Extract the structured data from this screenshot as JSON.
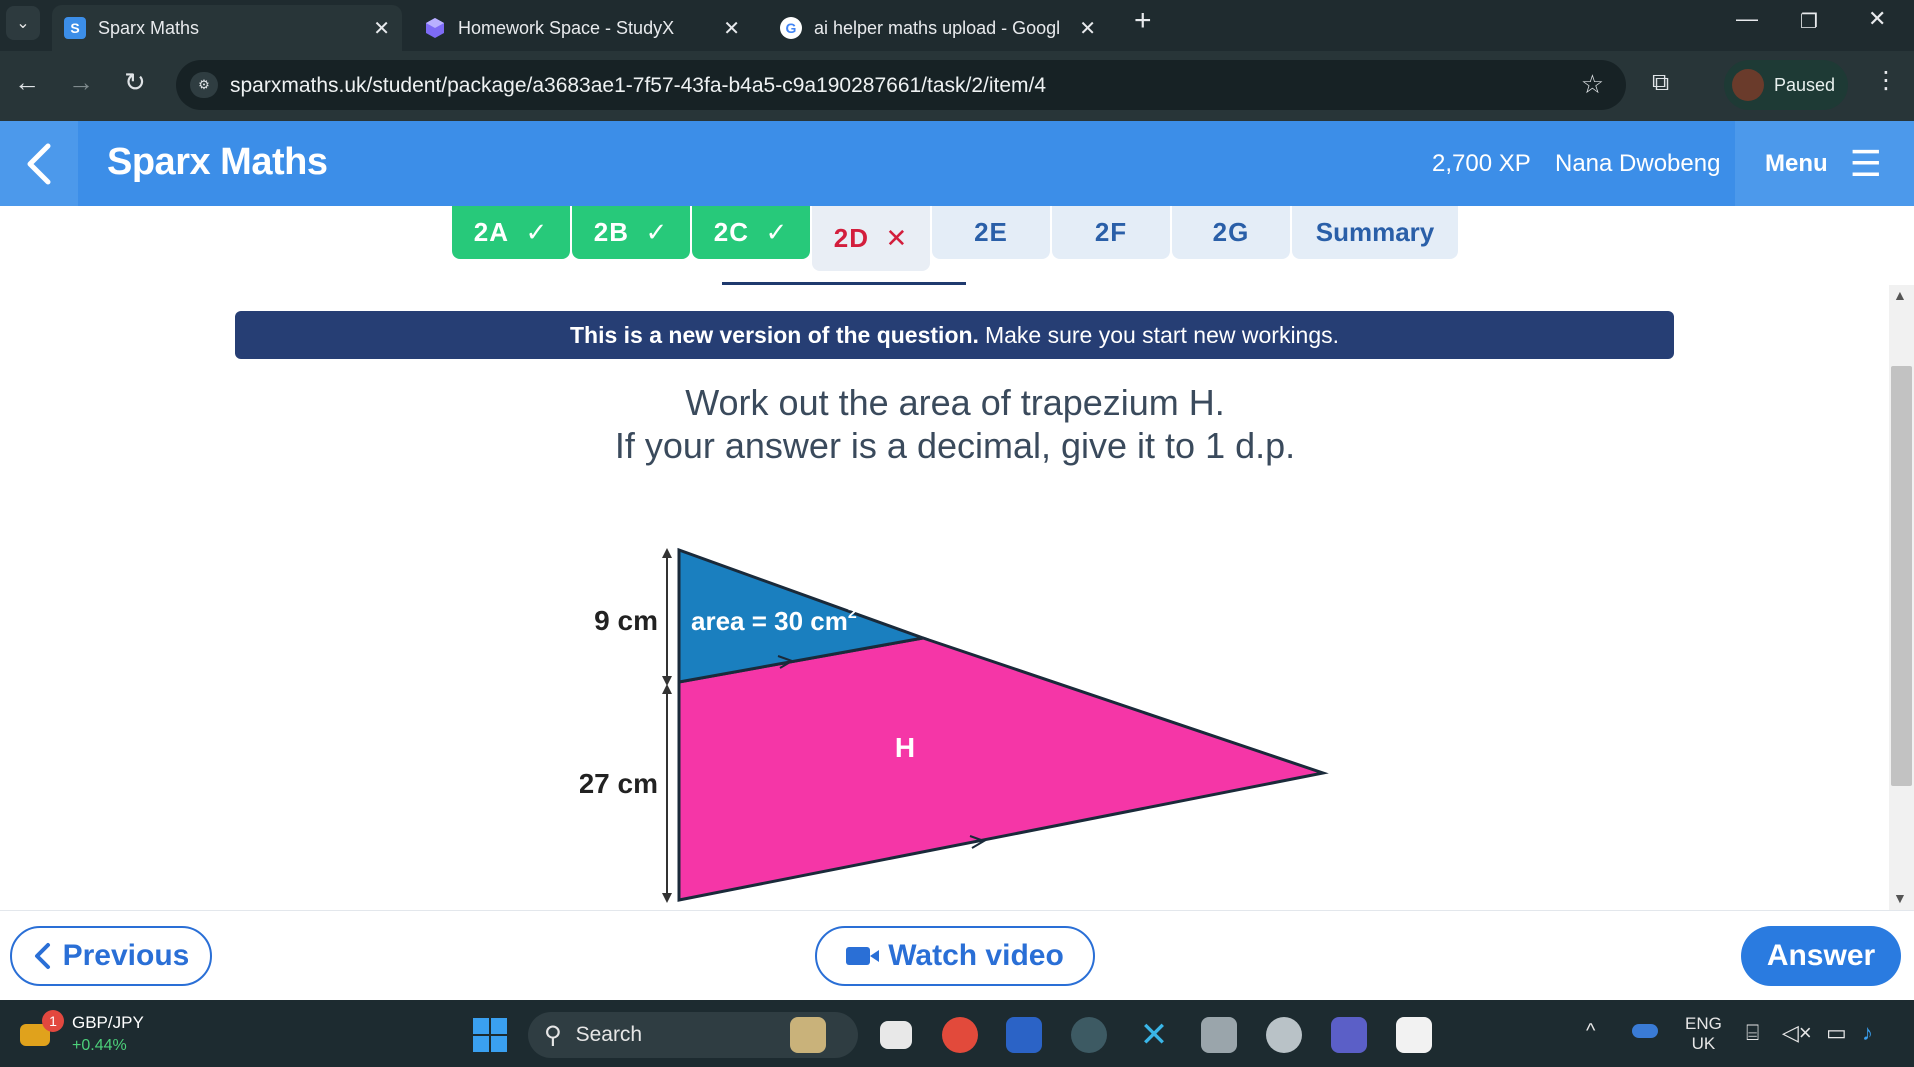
{
  "browser": {
    "tabs": [
      {
        "favicon": "S",
        "title": "Sparx Maths",
        "active": true
      },
      {
        "favicon": "studyx-cube",
        "title": "Homework Space - StudyX",
        "active": false
      },
      {
        "favicon": "G",
        "title": "ai helper maths upload - Googl",
        "active": false
      }
    ],
    "new_tab": "+",
    "url": "sparxmaths.uk/student/package/a3683ae1-7f57-43fa-b4a5-c9a190287661/task/2/item/4",
    "profile_status": "Paused"
  },
  "header": {
    "brand": "Sparx Maths",
    "xp": "2,700 XP",
    "user": "Nana Dwobeng",
    "menu": "Menu"
  },
  "task_tabs": [
    {
      "label": "2A",
      "status": "done",
      "mark": "✓"
    },
    {
      "label": "2B",
      "status": "done",
      "mark": "✓"
    },
    {
      "label": "2C",
      "status": "done",
      "mark": "✓"
    },
    {
      "label": "2D",
      "status": "wrong",
      "mark": "✕"
    },
    {
      "label": "2E",
      "status": "todo",
      "mark": ""
    },
    {
      "label": "2F",
      "status": "todo",
      "mark": ""
    },
    {
      "label": "2G",
      "status": "todo",
      "mark": ""
    },
    {
      "label": "Summary",
      "status": "todo",
      "mark": ""
    }
  ],
  "notice": {
    "bold": "This is a new version of the question.",
    "rest": "Make sure you start new workings."
  },
  "question": {
    "line1": "Work out the area of trapezium H.",
    "line2": "If your answer is a decimal, give it to 1 d.p."
  },
  "diagram": {
    "top_height_label": "9 cm",
    "bottom_height_label": "27 cm",
    "area_label": "area = 30 cm",
    "area_superscript": "2",
    "shape_label": "H",
    "colors": {
      "triangle": "#1a7fbf",
      "trapezium": "#f536a7",
      "outline": "#1a2a3a"
    }
  },
  "actions": {
    "previous": "Previous",
    "watch_video": "Watch video",
    "answer": "Answer"
  },
  "taskbar": {
    "notification_count": "1",
    "stock_name": "GBP/JPY",
    "stock_change": "+0.44%",
    "search": "Search",
    "language": "ENG",
    "region": "UK"
  }
}
